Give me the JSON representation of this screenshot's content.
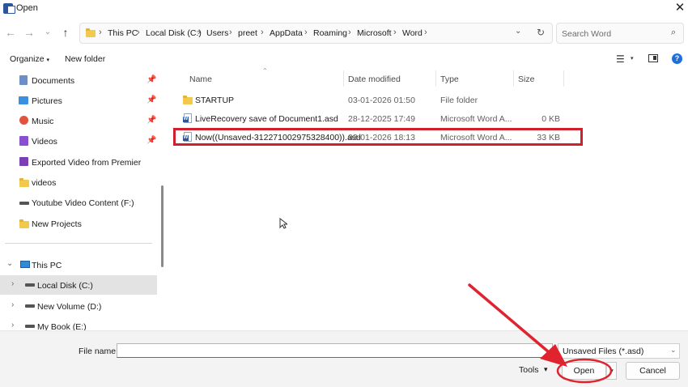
{
  "window": {
    "title": "Open"
  },
  "address": {
    "crumbs": [
      "This PC",
      "Local Disk (C:)",
      "Users",
      "preet",
      "AppData",
      "Roaming",
      "Microsoft",
      "Word"
    ]
  },
  "search": {
    "placeholder": "Search Word",
    "value": ""
  },
  "toolbar": {
    "organize": "Organize",
    "new_folder": "New folder"
  },
  "nav": {
    "items": [
      {
        "label": "Documents",
        "icon": "documents-icon"
      },
      {
        "label": "Pictures",
        "icon": "pictures-icon"
      },
      {
        "label": "Music",
        "icon": "music-icon"
      },
      {
        "label": "Videos",
        "icon": "videos-icon"
      },
      {
        "label": "Exported Video from Premier",
        "icon": "folder-icon"
      },
      {
        "label": "videos",
        "icon": "folder-icon"
      },
      {
        "label": "Youtube Video Content  (F:)",
        "icon": "drive-icon"
      },
      {
        "label": "New Projects",
        "icon": "folder-icon"
      }
    ],
    "tree": [
      {
        "label": "This PC",
        "icon": "computer-icon"
      },
      {
        "label": "Local Disk (C:)",
        "icon": "drive-icon"
      },
      {
        "label": "New Volume (D:)",
        "icon": "drive-icon"
      },
      {
        "label": "My Book (E:)",
        "icon": "drive-icon"
      }
    ]
  },
  "files": {
    "headers": [
      "Name",
      "Date modified",
      "Type",
      "Size"
    ],
    "rows": [
      {
        "name": "STARTUP",
        "date": "03-01-2026 01:50",
        "type": "File folder",
        "size": "",
        "icon": "folder-icon"
      },
      {
        "name": "LiveRecovery save of Document1.asd",
        "date": "28-12-2025 17:49",
        "type": "Microsoft Word A...",
        "size": "0 KB",
        "icon": "word-document-icon"
      },
      {
        "name": "Now((Unsaved-312271002975328400)).asd",
        "date": "03-01-2026 18:13",
        "type": "Microsoft Word A...",
        "size": "33 KB",
        "icon": "word-document-icon"
      }
    ]
  },
  "bottom": {
    "file_name_label": "File name:",
    "file_name_value": "",
    "file_type": "Unsaved Files (*.asd)",
    "tools": "Tools",
    "open": "Open",
    "cancel": "Cancel"
  },
  "colors": {
    "highlight": "#d0202d",
    "arrow": "#e0242f",
    "accent": "#2b579a"
  }
}
